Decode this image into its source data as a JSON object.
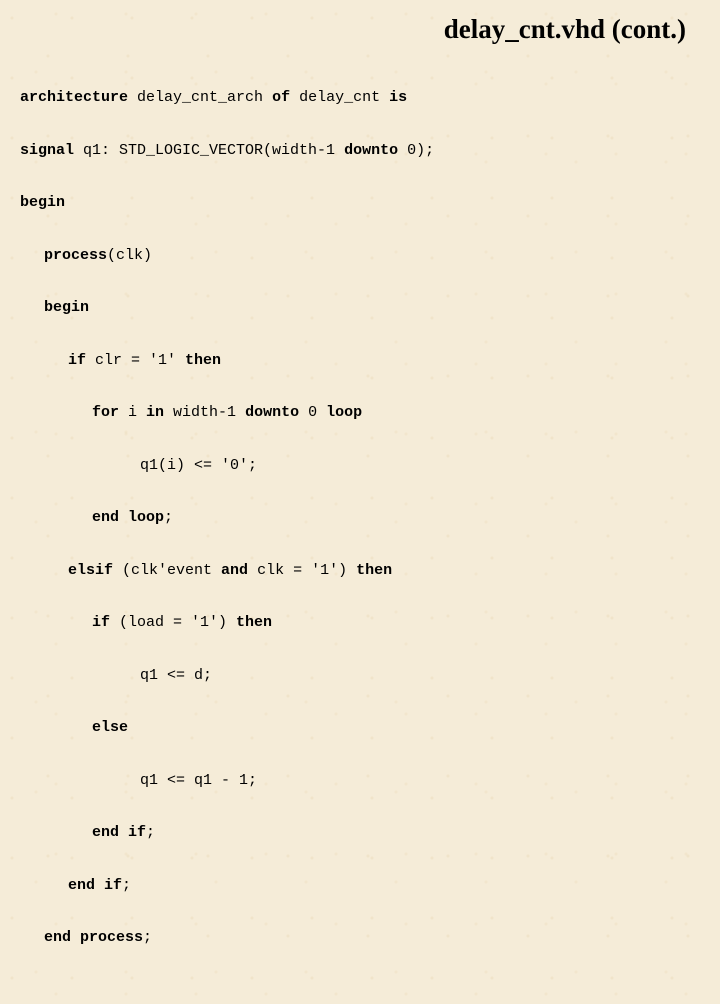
{
  "title": "delay_cnt.vhd (cont.)",
  "code": {
    "l1a": "architecture",
    "l1b": " delay_cnt_arch ",
    "l1c": "of",
    "l1d": " delay_cnt ",
    "l1e": "is",
    "l2a": "signal",
    "l2b": " q1: STD_LOGIC_VECTOR(width-1 ",
    "l2c": "downto",
    "l2d": " 0);",
    "l3": "begin",
    "l4a": "process",
    "l4b": "(clk)",
    "l5": "begin",
    "l6a": "if",
    "l6b": " clr = '1' ",
    "l6c": "then",
    "l7a": "for",
    "l7b": " i ",
    "l7c": "in",
    "l7d": " width-1 ",
    "l7e": "downto",
    "l7f": " 0 ",
    "l7g": "loop",
    "l8": "q1(i) <= '0';",
    "l9a": "end",
    "l9b": " ",
    "l9c": "loop",
    "l9d": ";",
    "l10a": "elsif",
    "l10b": " (clk'event ",
    "l10c": "and",
    "l10d": " clk = '1') ",
    "l10e": "then",
    "l11a": "if",
    "l11b": " (load = '1') ",
    "l11c": "then",
    "l12": "q1 <= d;",
    "l13": "else",
    "l14": "q1 <= q1 - 1;",
    "l15a": "end",
    "l15b": " ",
    "l15c": "if",
    "l15d": ";",
    "l16a": "end",
    "l16b": " ",
    "l16c": "if",
    "l16d": ";",
    "l17a": "end",
    "l17b": " ",
    "l17c": "process",
    "l17d": ";"
  }
}
